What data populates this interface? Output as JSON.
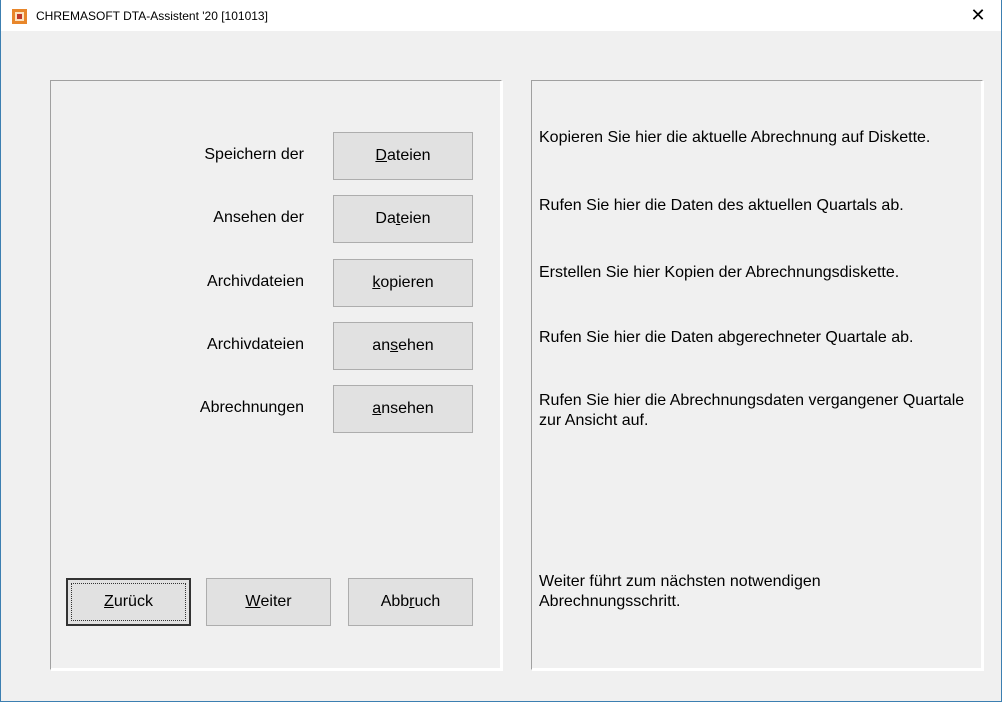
{
  "window": {
    "title": "CHREMASOFT DTA-Assistent '20 [101013]",
    "close_glyph": "✕",
    "icon": "chremasoft-app-icon"
  },
  "rows": [
    {
      "label": "Speichern der",
      "button_pre": "",
      "button_mnemonic": "D",
      "button_post": "ateien",
      "description": "Kopieren Sie hier die aktuelle Abrechnung auf Diskette."
    },
    {
      "label": "Ansehen der",
      "button_pre": "Da",
      "button_mnemonic": "t",
      "button_post": "eien",
      "description": "Rufen Sie hier die Daten des aktuellen Quartals ab."
    },
    {
      "label": "Archivdateien",
      "button_pre": "",
      "button_mnemonic": "k",
      "button_post": "opieren",
      "description": "Erstellen Sie hier Kopien der Abrechnungsdiskette."
    },
    {
      "label": "Archivdateien",
      "button_pre": "an",
      "button_mnemonic": "s",
      "button_post": "ehen",
      "description": "Rufen Sie hier die Daten abgerechneter Quartale ab."
    },
    {
      "label": "Abrechnungen",
      "button_pre": "",
      "button_mnemonic": "a",
      "button_post": "nsehen",
      "description": "Rufen Sie hier die Abrechnungsdaten vergangener Quartale zur Ansicht auf."
    }
  ],
  "nav": {
    "back": {
      "pre": "",
      "mnemonic": "Z",
      "post": "urück"
    },
    "next": {
      "pre": "",
      "mnemonic": "W",
      "post": "eiter"
    },
    "cancel": {
      "pre": "Abb",
      "mnemonic": "r",
      "post": "uch"
    },
    "hint": "Weiter führt zum nächsten notwendigen Abrechnungsschritt."
  }
}
